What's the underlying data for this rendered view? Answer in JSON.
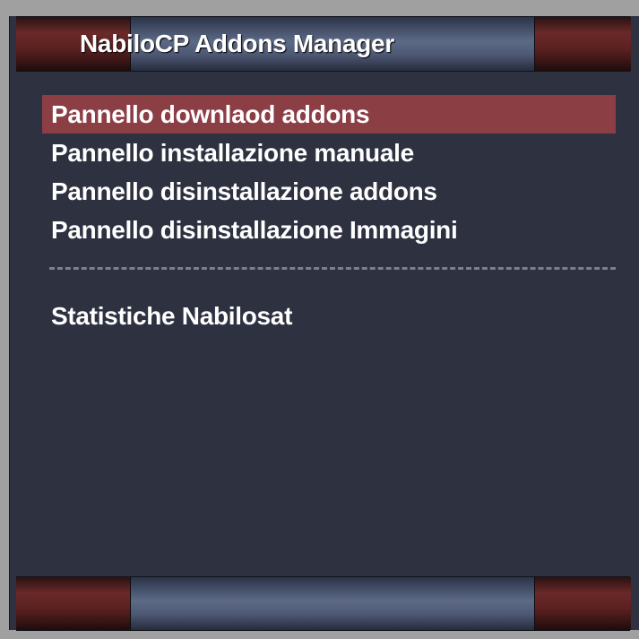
{
  "window": {
    "title": "NabiloCP Addons Manager"
  },
  "menu": {
    "items": [
      {
        "label": "Pannello downlaod addons",
        "selected": true
      },
      {
        "label": "Pannello installazione manuale",
        "selected": false
      },
      {
        "label": "Pannello disinstallazione addons",
        "selected": false
      },
      {
        "label": "Pannello disinstallazione Immagini",
        "selected": false
      }
    ],
    "extra_items": [
      {
        "label": "Statistiche Nabilosat",
        "selected": false
      }
    ]
  },
  "colors": {
    "background": "#2d3140",
    "selection": "#8c3e45",
    "text": "#ffffff",
    "separator": "#7d808c",
    "cap_red": "#6b2929",
    "bar_blue": "#5d6a86"
  }
}
